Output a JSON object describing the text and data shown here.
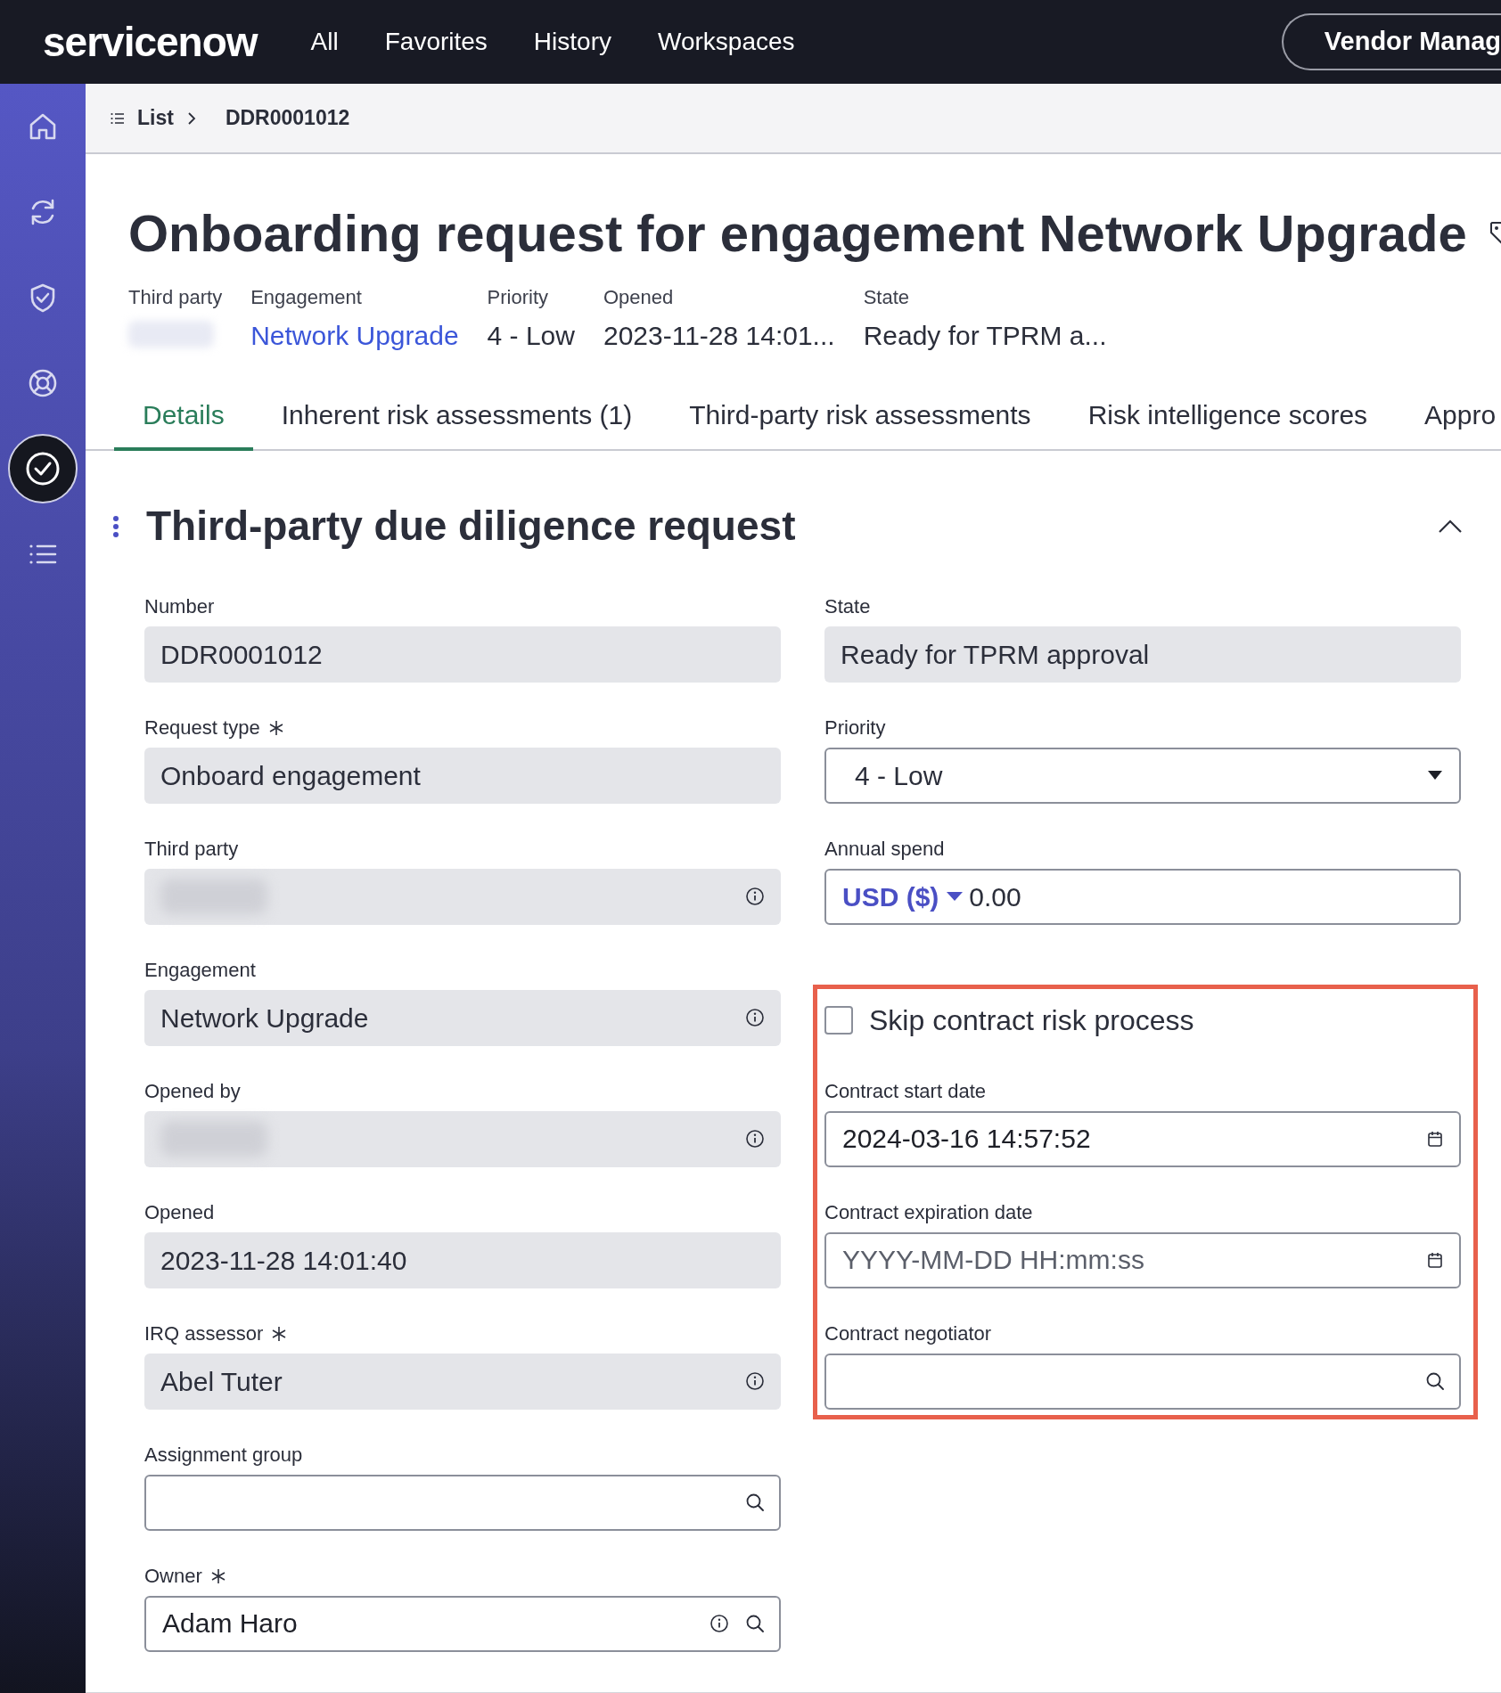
{
  "top_nav": {
    "logo": "servicenow",
    "menu": [
      "All",
      "Favorites",
      "History",
      "Workspaces"
    ],
    "workspace_button": "Vendor Manag"
  },
  "sidebar": {
    "items": [
      {
        "kind": "home",
        "selected": false
      },
      {
        "kind": "sync",
        "selected": false
      },
      {
        "kind": "shield",
        "selected": false
      },
      {
        "kind": "lifebuoy",
        "selected": false
      },
      {
        "kind": "check",
        "selected": true
      },
      {
        "kind": "list",
        "selected": false
      }
    ]
  },
  "breadcrumb": {
    "items": [
      "List",
      "DDR0001012"
    ]
  },
  "record": {
    "title": "Onboarding request for engagement Network Upgrade",
    "summary": [
      {
        "label": "Third party",
        "kind": "redacted"
      },
      {
        "label": "Engagement",
        "kind": "link",
        "value": "Network Upgrade"
      },
      {
        "label": "Priority",
        "kind": "text",
        "value": "4 - Low"
      },
      {
        "label": "Opened",
        "kind": "text",
        "value": "2023-11-28 14:01..."
      },
      {
        "label": "State",
        "kind": "text",
        "value": "Ready for TPRM a..."
      }
    ]
  },
  "tabs": [
    {
      "label": "Details",
      "selected": true
    },
    {
      "label": "Inherent risk assessments (1)",
      "selected": false
    },
    {
      "label": "Third-party risk assessments",
      "selected": false
    },
    {
      "label": "Risk intelligence scores",
      "selected": false
    },
    {
      "label": "Appro",
      "selected": false
    }
  ],
  "section": {
    "title": "Third-party due diligence request",
    "expanded": true,
    "left_fields": [
      {
        "label": "Number",
        "required": false,
        "kind": "readonly",
        "value": "DDR0001012"
      },
      {
        "label": "Request type",
        "required": true,
        "kind": "readonly",
        "value": "Onboard engagement"
      },
      {
        "label": "Third party",
        "required": false,
        "kind": "readonly",
        "redacted": true,
        "info": true
      },
      {
        "label": "Engagement",
        "required": false,
        "kind": "readonly",
        "value": "Network Upgrade",
        "info": true
      },
      {
        "label": "Opened by",
        "required": false,
        "kind": "readonly",
        "redacted": true,
        "info": true
      },
      {
        "label": "Opened",
        "required": false,
        "kind": "readonly",
        "value": "2023-11-28 14:01:40"
      },
      {
        "label": "IRQ assessor",
        "required": true,
        "kind": "readonly",
        "value": "Abel Tuter",
        "info": true
      },
      {
        "label": "Assignment group",
        "required": false,
        "kind": "input",
        "search": true
      },
      {
        "label": "Owner",
        "required": true,
        "kind": "input",
        "value": "Adam Haro",
        "info": true,
        "search": true
      }
    ],
    "right_fields": [
      {
        "label": "State",
        "required": false,
        "kind": "readonly",
        "value": "Ready for TPRM approval"
      },
      {
        "label": "Priority",
        "required": false,
        "kind": "select",
        "value": "4 - Low"
      },
      {
        "label": "Annual spend",
        "required": false,
        "kind": "currency",
        "currency": "USD ($)",
        "value": "0.00"
      }
    ],
    "highlight_box": {
      "fields": [
        {
          "label": "Skip contract risk process",
          "kind": "checkbox",
          "checked": false
        },
        {
          "label": "Contract start date",
          "required": false,
          "kind": "input",
          "value": "2024-03-16 14:57:52",
          "calendar": true
        },
        {
          "label": "Contract expiration date",
          "required": false,
          "kind": "input",
          "placeholder": "YYYY-MM-DD HH:mm:ss",
          "calendar": true
        },
        {
          "label": "Contract negotiator",
          "required": false,
          "kind": "input",
          "search": true
        }
      ]
    }
  }
}
